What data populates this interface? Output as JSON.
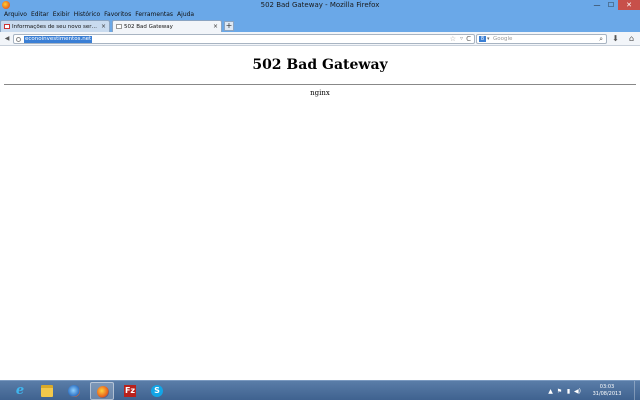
{
  "window": {
    "title": "502 Bad Gateway - Mozilla Firefox",
    "minimize": "—",
    "maximize": "☐",
    "close": "✕"
  },
  "menu": [
    "Arquivo",
    "Editar",
    "Exibir",
    "Histórico",
    "Favoritos",
    "Ferramentas",
    "Ajuda"
  ],
  "tabs": [
    {
      "label": "Informações de seu novo servidor - e...",
      "close": "×"
    },
    {
      "label": "502 Bad Gateway",
      "close": "×"
    }
  ],
  "newtab_label": "+",
  "navbar": {
    "back": "◀",
    "url": "econoinvestimentos.net",
    "star": "☆",
    "dropmarker": "▿",
    "reload": "C",
    "search_engine": "8",
    "search_placeholder": "Google",
    "search_button": "⌕",
    "downloads": "⬇",
    "home": "⌂"
  },
  "page": {
    "heading": "502 Bad Gateway",
    "server": "nginx"
  },
  "taskbar": {
    "apps": [
      {
        "name": "ie-icon",
        "glyph": "e"
      },
      {
        "name": "file-explorer-icon",
        "glyph": ""
      },
      {
        "name": "firefox-sync-icon",
        "glyph": ""
      },
      {
        "name": "firefox-icon",
        "glyph": ""
      },
      {
        "name": "filezilla-icon",
        "glyph": "Fz"
      },
      {
        "name": "skype-icon",
        "glyph": "S"
      }
    ],
    "tray": {
      "chevron": "▲",
      "flag": "⚑",
      "network": "▮",
      "volume": "◀)",
      "time": "03:03",
      "date": "31/08/2013"
    }
  }
}
